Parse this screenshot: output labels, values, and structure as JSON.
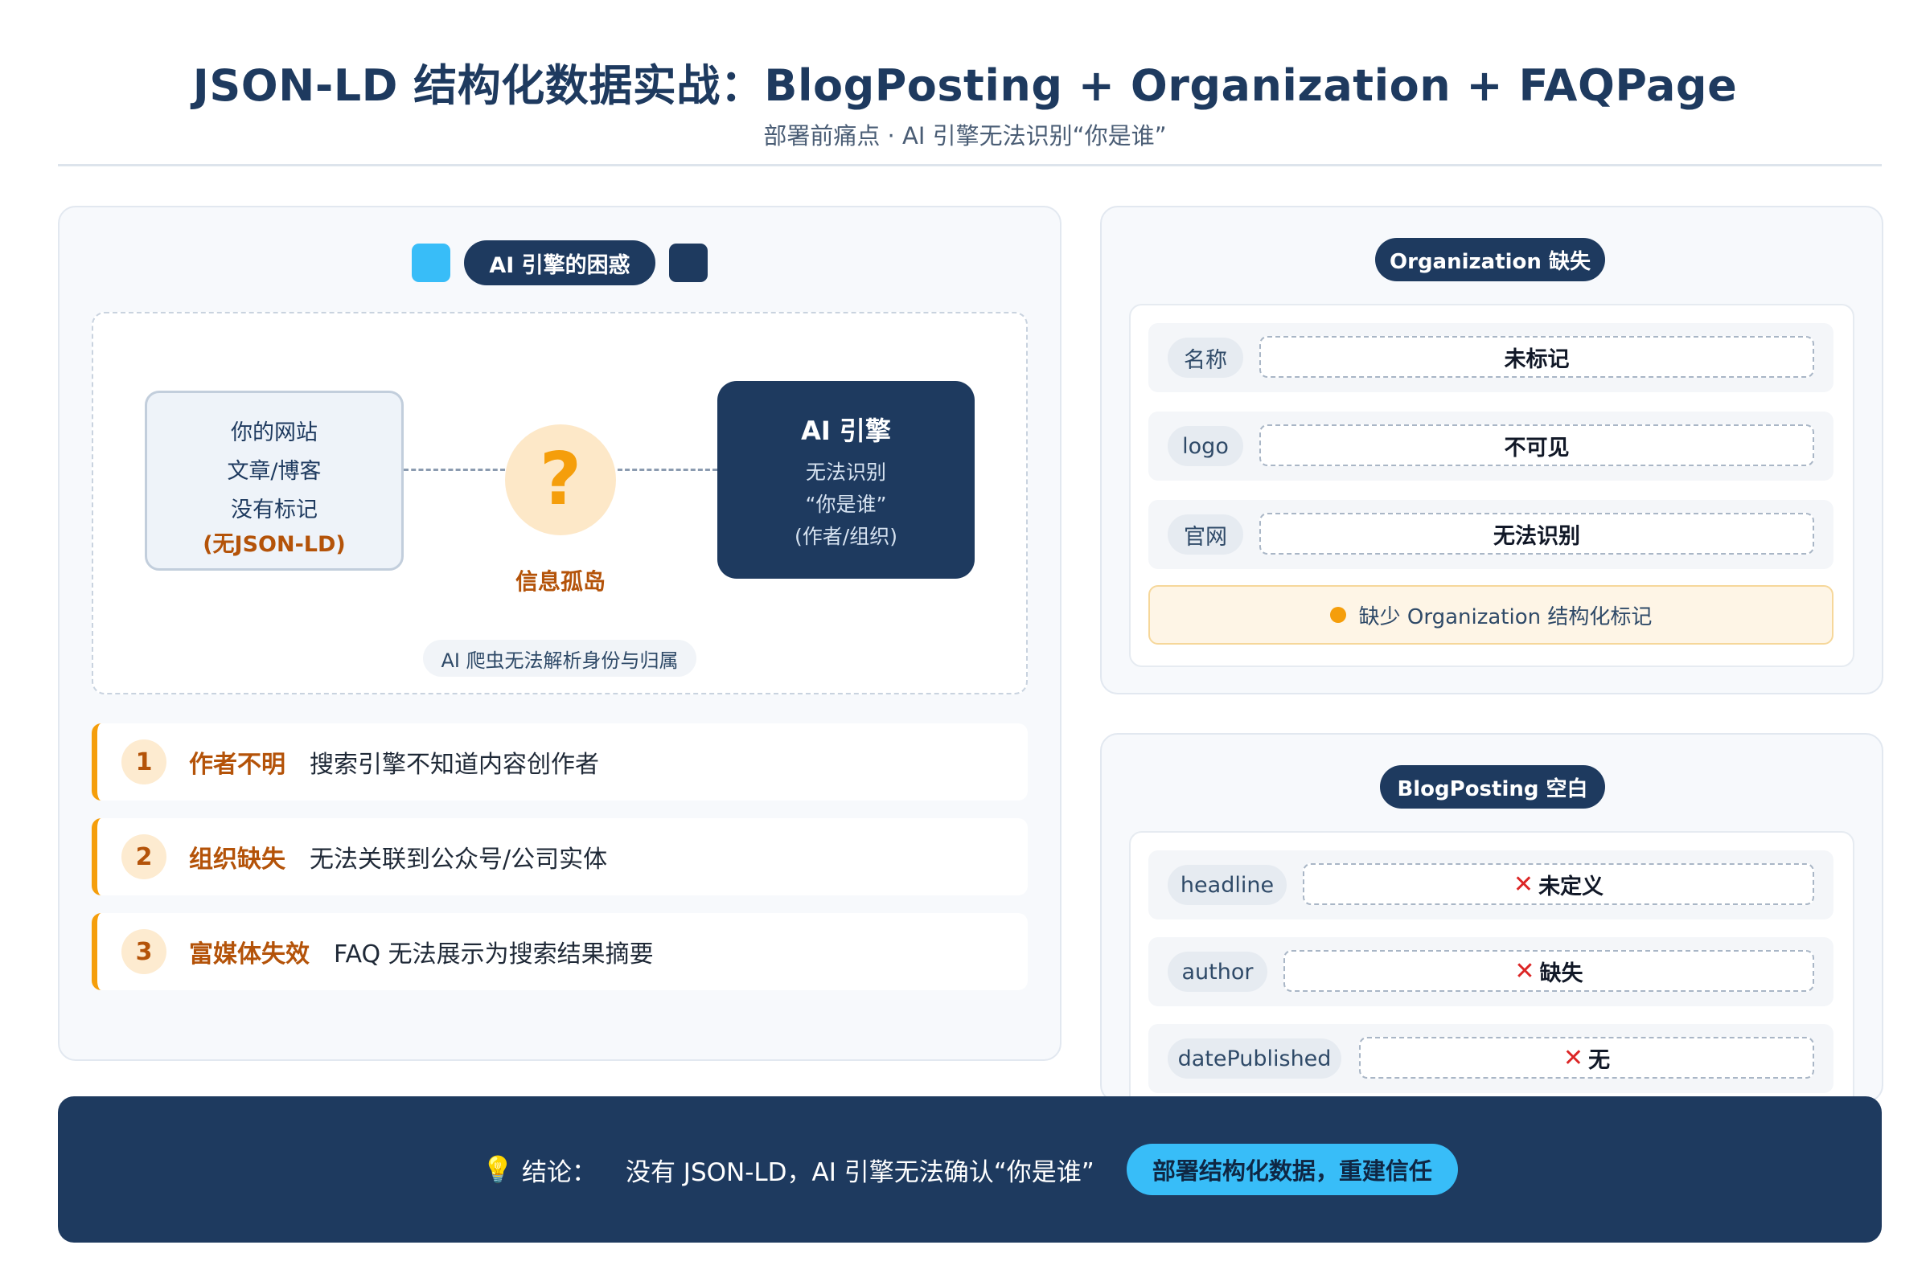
{
  "header": {
    "title": "JSON-LD 结构化数据实战：BlogPosting + Organization + FAQPage",
    "subtitle": "部署前痛点 · AI 引擎无法识别“你是谁”"
  },
  "colors": {
    "navy": "#1e3a5f",
    "accent_blue": "#38bdf8",
    "accent_orange": "#f59e0b",
    "error_red": "#dc2626"
  },
  "left_panel": {
    "legend_label": "AI 引擎的困惑",
    "site_box": {
      "lines": [
        "你的网站",
        "文章/博客",
        "没有标记",
        "(无JSON-LD)"
      ]
    },
    "question_icon": "question-mark-icon",
    "question_caption": "信息孤岛",
    "ai_box": {
      "title": "AI 引擎",
      "lines": [
        "无法识别",
        "“你是谁”",
        "(作者/组织)"
      ]
    },
    "diagram_note": "AI 爬虫无法解析身份与归属",
    "pain_points": [
      {
        "num": "1",
        "title": "作者不明",
        "desc": "搜索引擎不知道内容创作者"
      },
      {
        "num": "2",
        "title": "组织缺失",
        "desc": "无法关联到公众号/公司实体"
      },
      {
        "num": "3",
        "title": "富媒体失效",
        "desc": "FAQ 无法展示为搜索结果摘要"
      }
    ]
  },
  "org_panel": {
    "title": "Organization 缺失",
    "rows": [
      {
        "key": "名称",
        "value": "未标记"
      },
      {
        "key": "logo",
        "value": "不可见"
      },
      {
        "key": "官网",
        "value": "无法识别"
      }
    ],
    "warning": "缺少 Organization 结构化标记"
  },
  "blog_panel": {
    "title": "BlogPosting 空白",
    "rows": [
      {
        "key": "headline",
        "value": "未定义",
        "icon": "cross-mark-icon"
      },
      {
        "key": "author",
        "value": "缺失",
        "icon": "cross-mark-icon"
      },
      {
        "key": "datePublished",
        "value": "无",
        "icon": "cross-mark-icon"
      }
    ]
  },
  "banner": {
    "icon": "lightbulb-icon",
    "label": "结论：",
    "text": "没有 JSON-LD，AI 引擎无法确认“你是谁”",
    "cta": "部署结构化数据，重建信任"
  }
}
